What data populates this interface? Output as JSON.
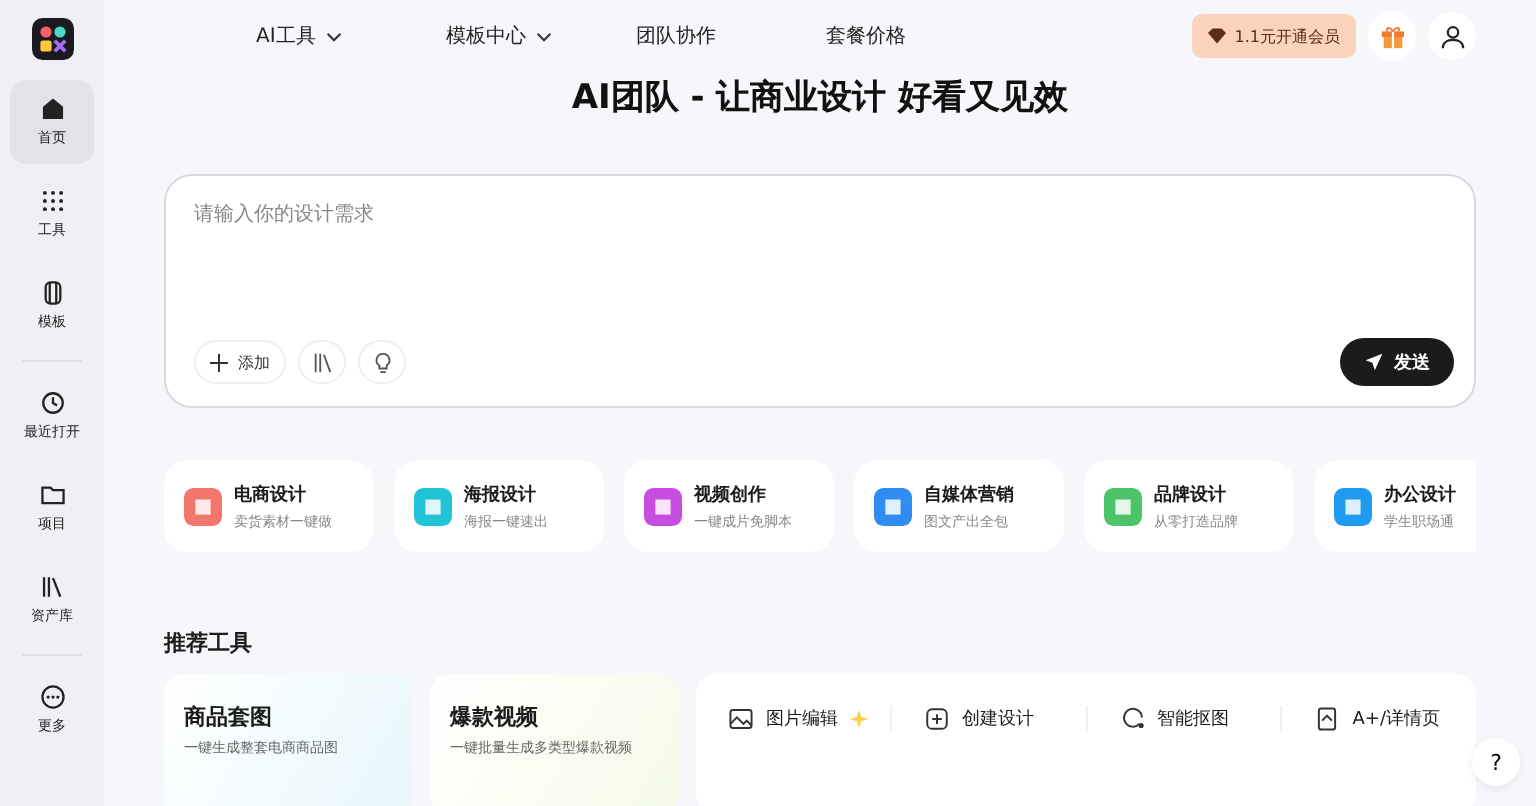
{
  "sidebar": {
    "items": [
      {
        "label": "首页",
        "selected": true
      },
      {
        "label": "工具",
        "selected": false
      },
      {
        "label": "模板",
        "selected": false
      },
      {
        "label": "最近打开",
        "selected": false
      },
      {
        "label": "项目",
        "selected": false
      },
      {
        "label": "资产库",
        "selected": false
      },
      {
        "label": "更多",
        "selected": false
      }
    ]
  },
  "nav": {
    "items": [
      {
        "label": "AI工具",
        "dropdown": true
      },
      {
        "label": "模板中心",
        "dropdown": true
      },
      {
        "label": "团队协作",
        "dropdown": false
      },
      {
        "label": "套餐价格",
        "dropdown": false
      }
    ],
    "vip_button": "1.1元开通会员"
  },
  "title": "AI团队 - 让商业设计 好看又见效",
  "prompt": {
    "placeholder": "请输入你的设计需求",
    "add_button": "添加",
    "send_button": "发送"
  },
  "categories": [
    {
      "title": "电商设计",
      "subtitle": "卖货素材一键做",
      "color": "#f2766b"
    },
    {
      "title": "海报设计",
      "subtitle": "海报一键速出",
      "color": "#22c3d6"
    },
    {
      "title": "视频创作",
      "subtitle": "一键成片免脚本",
      "color": "#c64de0"
    },
    {
      "title": "自媒体营销",
      "subtitle": "图文产出全包",
      "color": "#2f8cf0"
    },
    {
      "title": "品牌设计",
      "subtitle": "从零打造品牌",
      "color": "#4cc46a"
    },
    {
      "title": "办公设计",
      "subtitle": "学生职场通",
      "color": "#1e9bf0"
    }
  ],
  "recommended": {
    "heading": "推荐工具",
    "cards": [
      {
        "title": "商品套图",
        "subtitle": "一键生成整套电商商品图"
      },
      {
        "title": "爆款视频",
        "subtitle": "一键批量生成多类型爆款视频"
      }
    ],
    "tools": [
      {
        "label": "图片编辑",
        "sparkle": true
      },
      {
        "label": "创建设计",
        "sparkle": false
      },
      {
        "label": "智能抠图",
        "sparkle": false
      },
      {
        "label": "A+/详情页",
        "sparkle": false
      }
    ]
  },
  "help_button": "?"
}
